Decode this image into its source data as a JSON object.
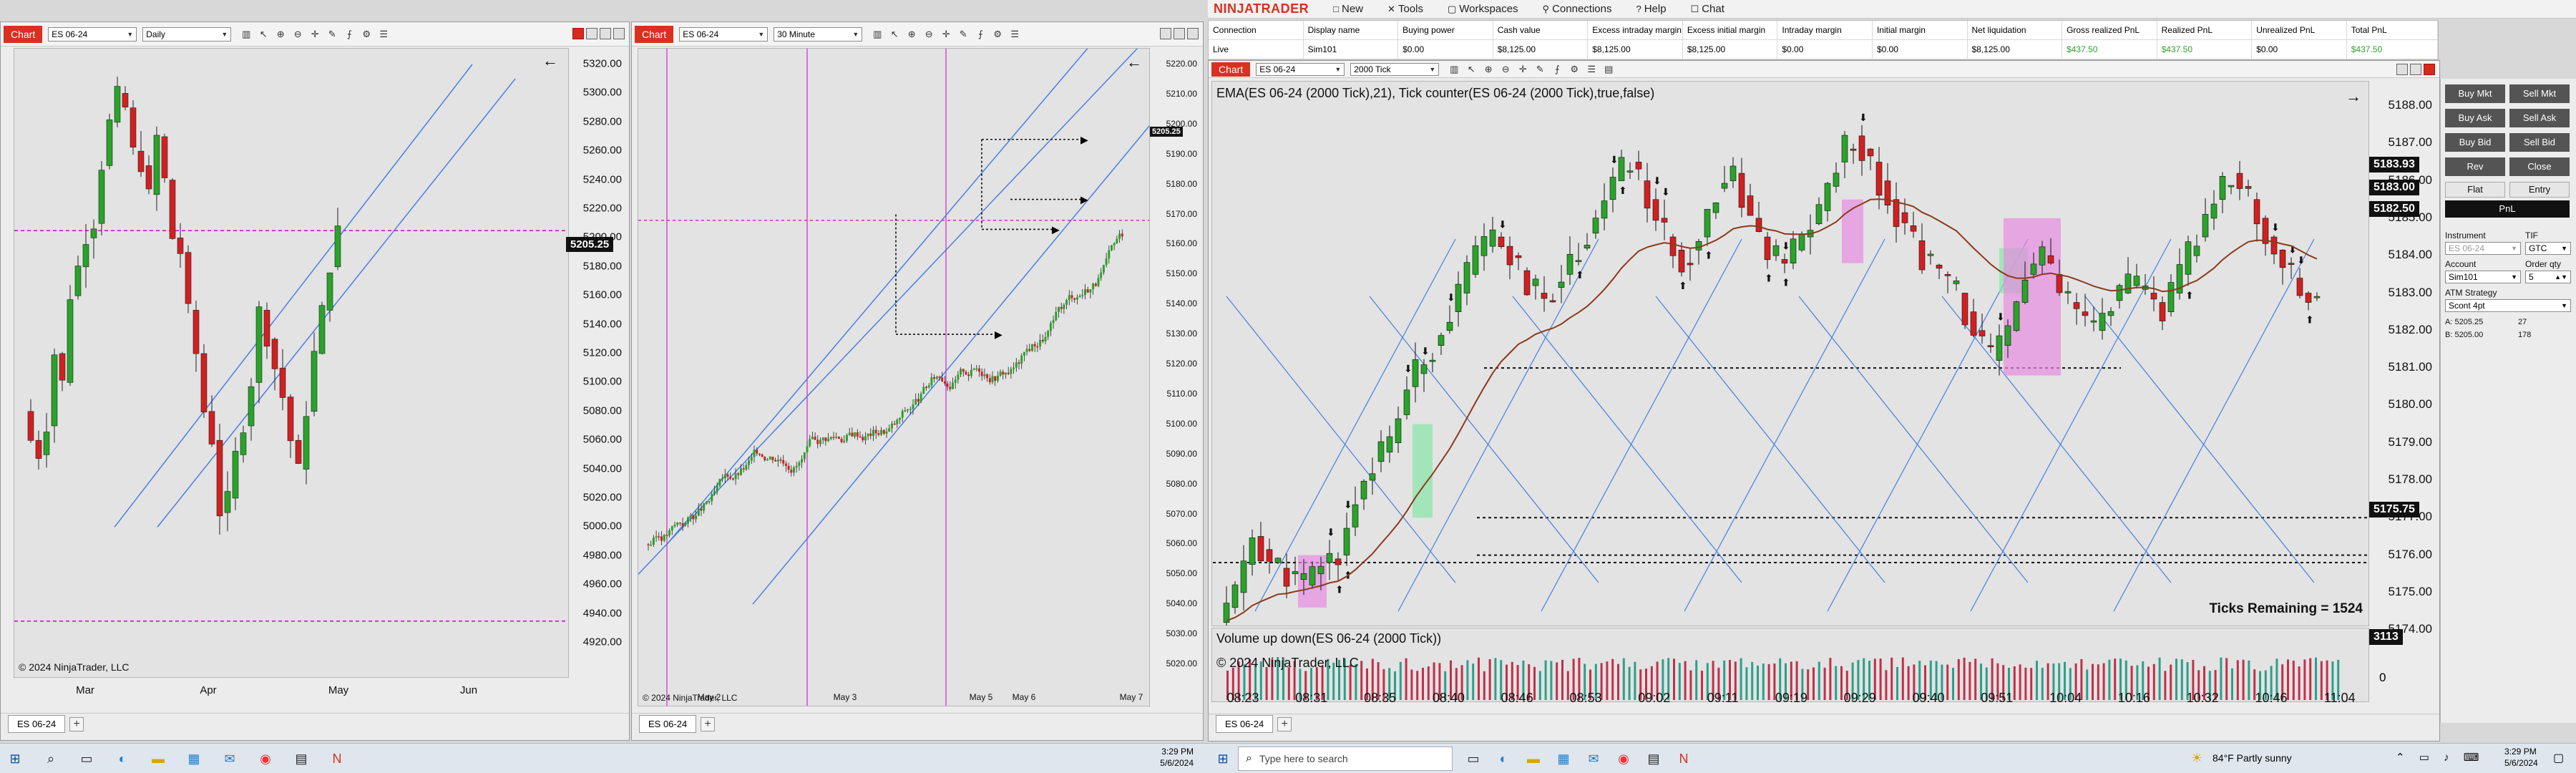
{
  "left_chart": {
    "tag": "Chart",
    "instrument": "ES 06-24",
    "interval": "Daily",
    "y_ticks": [
      "5320.00",
      "5300.00",
      "5280.00",
      "5260.00",
      "5240.00",
      "5220.00",
      "5200.00",
      "5180.00",
      "5160.00",
      "5140.00",
      "5120.00",
      "5100.00",
      "5080.00",
      "5060.00",
      "5040.00",
      "5020.00",
      "5000.00",
      "4980.00",
      "4960.00",
      "4940.00",
      "4920.00"
    ],
    "price_tag": "5205.25",
    "x_ticks": [
      "Mar",
      "Apr",
      "May",
      "Jun"
    ],
    "copyright": "© 2024 NinjaTrader, LLC",
    "tab": "ES 06-24"
  },
  "mid_chart": {
    "tag": "Chart",
    "instrument": "ES 06-24",
    "interval": "30 Minute",
    "y_ticks": [
      "5220.00",
      "5210.00",
      "5200.00",
      "5190.00",
      "5180.00",
      "5170.00",
      "5160.00",
      "5150.00",
      "5140.00",
      "5130.00",
      "5120.00",
      "5110.00",
      "5100.00",
      "5090.00",
      "5080.00",
      "5070.00",
      "5060.00",
      "5050.00",
      "5040.00",
      "5030.00",
      "5020.00"
    ],
    "price_tag": "5205.25",
    "x_ticks": [
      "May 2",
      "May 3",
      "May 5",
      "May 6",
      "May 7"
    ],
    "copyright": "© 2024 NinjaTrader, LLC",
    "tab": "ES 06-24"
  },
  "main_window": {
    "logo": "NINJATRADER",
    "menu": [
      {
        "icon": "new-icon",
        "label": "New"
      },
      {
        "icon": "tools-icon",
        "label": "Tools"
      },
      {
        "icon": "workspaces-icon",
        "label": "Workspaces"
      },
      {
        "icon": "connections-icon",
        "label": "Connections"
      },
      {
        "icon": "help-icon",
        "label": "Help"
      },
      {
        "icon": "chat-icon",
        "label": "Chat"
      }
    ],
    "account_table": {
      "headers": [
        "Connection",
        "Display name",
        "Buying power",
        "Cash value",
        "Excess intraday margin",
        "Excess initial margin",
        "Intraday margin",
        "Initial margin",
        "Net liquidation",
        "Gross realized PnL",
        "Realized PnL",
        "Unrealized PnL",
        "Total PnL"
      ],
      "row": [
        "Live",
        "Sim101",
        "$0.00",
        "$8,125.00",
        "$8,125.00",
        "$8,125.00",
        "$0.00",
        "$0.00",
        "$8,125.00",
        "$437.50",
        "$437.50",
        "$0.00",
        "$437.50"
      ]
    }
  },
  "tick_chart": {
    "tag": "Chart",
    "instrument": "ES 06-24",
    "interval": "2000 Tick",
    "indicator_label": "EMA(ES 06-24 (2000 Tick),21), Tick counter(ES 06-24 (2000 Tick),true,false)",
    "y_ticks": [
      "5188.00",
      "5187.00",
      "5186.00",
      "5185.00",
      "5184.00",
      "5183.00",
      "5182.00",
      "5181.00",
      "5180.00",
      "5179.00",
      "5178.00",
      "5177.00",
      "5176.00",
      "5175.00",
      "5174.00"
    ],
    "price_tags": [
      "5183.93",
      "5183.00",
      "5182.50",
      "5175.75"
    ],
    "ticks_remaining": "Ticks Remaining = 1524",
    "volume_label": "Volume up down(ES 06-24 (2000 Tick))",
    "volume_tag": "3113",
    "volume_zero": "0",
    "copyright": "© 2024 NinjaTrader, LLC",
    "x_ticks": [
      "08:23",
      "08:31",
      "08:35",
      "08:40",
      "08:46",
      "08:53",
      "09:02",
      "09:11",
      "09:19",
      "09:29",
      "09:40",
      "09:51",
      "10:04",
      "10:16",
      "10:32",
      "10:46",
      "11:04"
    ],
    "tab": "ES 06-24"
  },
  "order_panel": {
    "buttons": [
      "Buy Mkt",
      "Sell Mkt",
      "Buy Ask",
      "Sell Ask",
      "Buy Bid",
      "Sell Bid",
      "Rev",
      "Close"
    ],
    "flat": "Flat",
    "entry": "Entry",
    "pnl": "PnL",
    "instrument_label": "Instrument",
    "instrument_value": "ES 06-24",
    "tif_label": "TIF",
    "tif_value": "GTC",
    "account_label": "Account",
    "account_value": "Sim101",
    "order_qty_label": "Order qty",
    "order_qty_value": "5",
    "atm_label": "ATM Strategy",
    "atm_value": "Scont 4pt",
    "ask_line": "A: 5205.25",
    "ask_size": "27",
    "bid_line": "B: 5205.00",
    "bid_size": "178"
  },
  "taskbar_left": {
    "time": "3:29 PM",
    "date": "5/6/2024"
  },
  "taskbar_right": {
    "search_placeholder": "Type here to search",
    "weather": "84°F  Partly sunny",
    "time": "3:29 PM",
    "date": "5/6/2024"
  },
  "colors": {
    "bull": "#29a329",
    "bear": "#d12020",
    "trend": "#4a7fe0",
    "magenta": "#cc00cc",
    "ema": "#8b3a1a"
  }
}
